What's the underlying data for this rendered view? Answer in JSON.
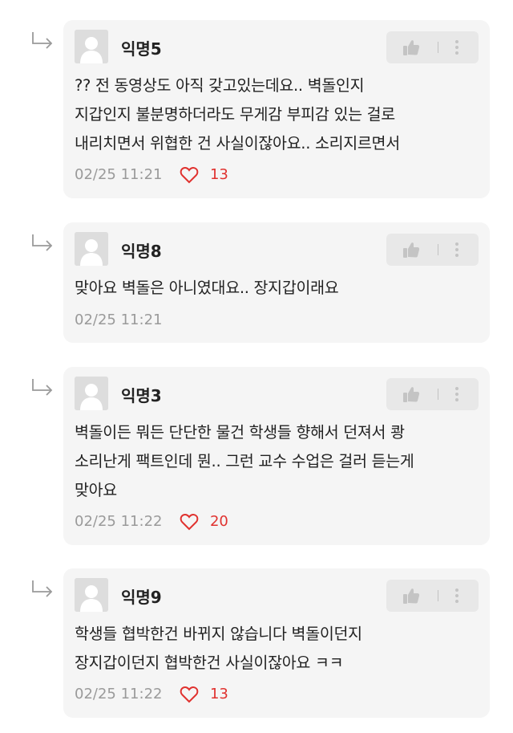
{
  "colors": {
    "card_bg": "#f5f5f5",
    "like_red": "#e0322f",
    "meta_gray": "#9a9a9a",
    "text": "#222222"
  },
  "comments": [
    {
      "author": "익명5",
      "text": "?? 전 동영상도 아직 갖고있는데요.. 벽돌인지\n지갑인지 불분명하더라도 무게감 부피감 있는 걸로\n내리치면서 위협한 건 사실이잖아요.. 소리지르면서",
      "time": "02/25 11:21",
      "likes": "13"
    },
    {
      "author": "익명8",
      "text": "맞아요 벽돌은 아니였대요.. 장지갑이래요",
      "time": "02/25 11:21",
      "likes": ""
    },
    {
      "author": "익명3",
      "text": "벽돌이든 뭐든 단단한 물건 학생들 향해서 던져서 쾅\n소리난게 팩트인데 뭔.. 그런 교수 수업은 걸러 듣는게\n맞아요",
      "time": "02/25 11:22",
      "likes": "20"
    },
    {
      "author": "익명9",
      "text": "학생들 협박한건 바뀌지 않습니다 벽돌이던지\n장지갑이던지 협박한건 사실이잖아요 ㅋㅋ",
      "time": "02/25 11:22",
      "likes": "13"
    }
  ],
  "icons": {
    "reply_arrow": "reply-arrow-icon",
    "avatar": "default-avatar-icon",
    "like": "thumbs-up-icon",
    "more": "more-vertical-icon",
    "heart": "heart-outline-icon"
  }
}
